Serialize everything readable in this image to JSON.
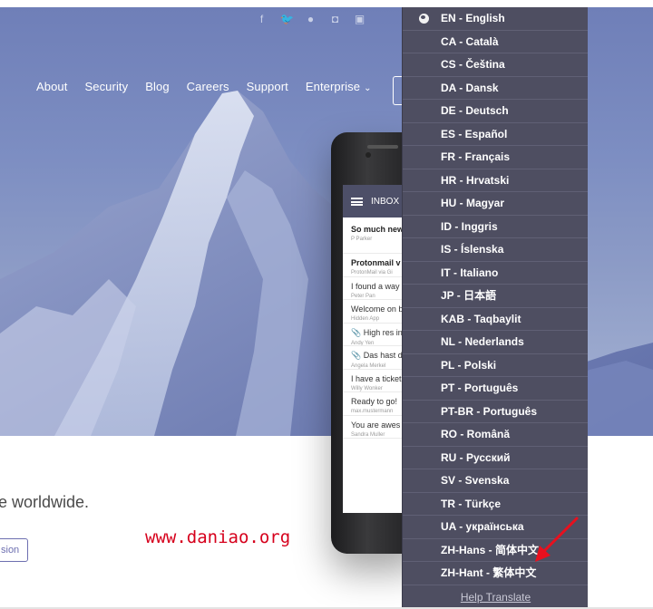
{
  "social": [
    {
      "icon": "facebook-icon",
      "glyph": "f"
    },
    {
      "icon": "twitter-icon",
      "glyph": "🐦"
    },
    {
      "icon": "reddit-icon",
      "glyph": "●"
    },
    {
      "icon": "instagram-icon",
      "glyph": "◘"
    },
    {
      "icon": "mastodon-icon",
      "glyph": "▣"
    }
  ],
  "nav": {
    "about": "About",
    "security": "Security",
    "blog": "Blog",
    "careers": "Careers",
    "support": "Support",
    "enterprise": "Enterprise",
    "enterprise_chevron": "⌄"
  },
  "phone": {
    "inbox_title": "INBOX",
    "messages": [
      {
        "title": "So much new",
        "sender": "P Parker"
      },
      {
        "title": "Protonmail v",
        "sender": "ProtonMail via Gi"
      },
      {
        "title": "I found a way",
        "sender": "Peter Pan"
      },
      {
        "title": "Welcome on b",
        "sender": "Hidden App"
      },
      {
        "title": "📎 High res in",
        "sender": "Andy Yen"
      },
      {
        "title": "📎 Das hast d",
        "sender": "Angela Merkel"
      },
      {
        "title": "I have a ticket",
        "sender": "Willy Wonker"
      },
      {
        "title": "Ready to go!",
        "sender": "max.mustermann"
      },
      {
        "title": "You are awes",
        "sender": "Sandra Muller"
      }
    ]
  },
  "page": {
    "tagline": "e worldwide.",
    "cta_label": "sion",
    "watermark": "www.daniao.org"
  },
  "languages": [
    "EN - English",
    "CA - Català",
    "CS - Čeština",
    "DA - Dansk",
    "DE - Deutsch",
    "ES - Español",
    "FR - Français",
    "HR - Hrvatski",
    "HU - Magyar",
    "ID - Inggris",
    "IS - Íslenska",
    "IT - Italiano",
    "JP - 日本語",
    "KAB - Taqbaylit",
    "NL - Nederlands",
    "PL - Polski",
    "PT - Português",
    "PT-BR - Português",
    "RO - Română",
    "RU - Русский",
    "SV - Svenska",
    "TR - Türkçe",
    "UA - українська",
    "ZH-Hans - 简体中文",
    "ZH-Hant - 繁体中文"
  ],
  "help_translate": "Help Translate",
  "colors": {
    "dropdown_bg": "#4e4e61",
    "accent": "#6d6fb0",
    "watermark": "#d6001c",
    "arrow": "#e8101e"
  }
}
